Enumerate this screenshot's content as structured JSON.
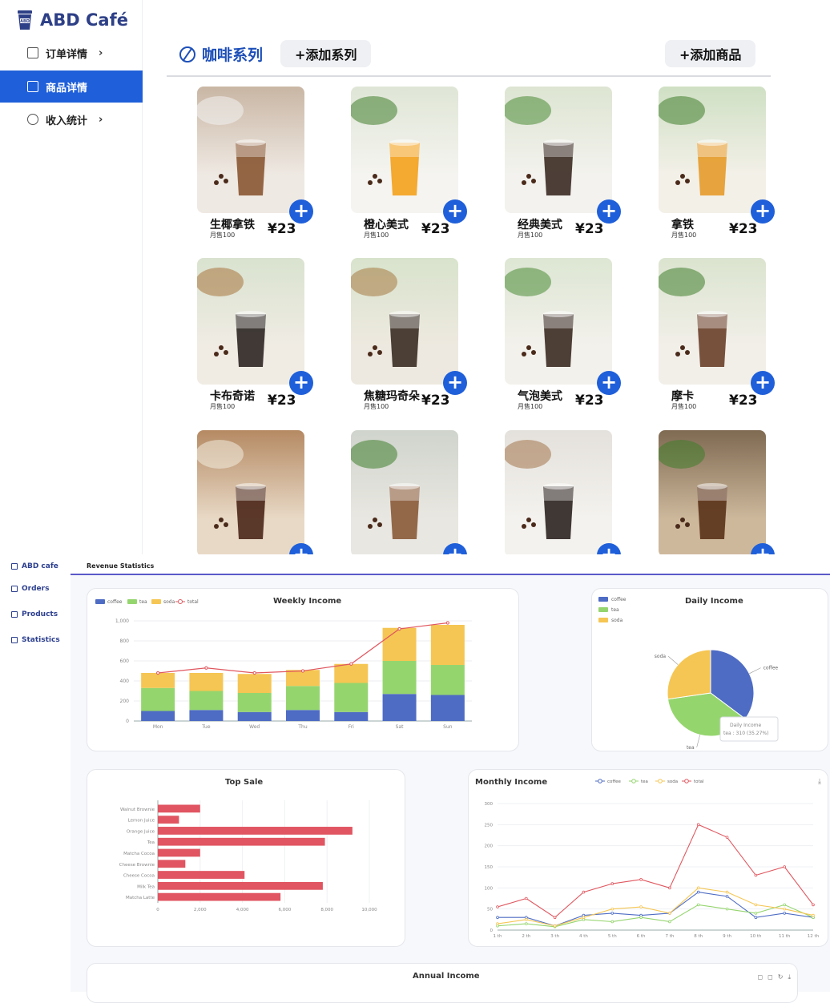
{
  "top": {
    "brand": "ABD Café",
    "nav": [
      {
        "label": "订单详情",
        "chevron": "›",
        "active": false
      },
      {
        "label": "商品详情",
        "chevron": "",
        "active": true
      },
      {
        "label": "收入统计",
        "chevron": "›",
        "active": false
      }
    ],
    "series_title": "咖啡系列",
    "add_series_label": "+添加系列",
    "add_product_label": "+添加商品",
    "plus_glyph": "+",
    "accent": "#1f5fd9",
    "products": [
      {
        "name": "生椰拿铁",
        "sold": "月售100",
        "price": "¥23"
      },
      {
        "name": "橙心美式",
        "sold": "月售100",
        "price": "¥23"
      },
      {
        "name": "经典美式",
        "sold": "月售100",
        "price": "¥23"
      },
      {
        "name": "拿铁",
        "sold": "月售100",
        "price": "¥23"
      },
      {
        "name": "卡布奇诺",
        "sold": "月售100",
        "price": "¥23"
      },
      {
        "name": "焦糖玛奇朵",
        "sold": "月售100",
        "price": "¥23"
      },
      {
        "name": "气泡美式",
        "sold": "月售100",
        "price": "¥23"
      },
      {
        "name": "摩卡",
        "sold": "月售100",
        "price": "¥23"
      },
      {
        "name": "",
        "sold": "",
        "price": ""
      },
      {
        "name": "",
        "sold": "",
        "price": ""
      },
      {
        "name": "",
        "sold": "",
        "price": ""
      },
      {
        "name": "",
        "sold": "",
        "price": ""
      }
    ]
  },
  "bottom": {
    "brand": "ABD cafe",
    "nav": [
      "Orders",
      "Products",
      "Statistics"
    ],
    "header_title": "Revenue Statistics",
    "colors": {
      "coffee": "#4e6cc4",
      "tea": "#95d56e",
      "soda": "#f5c653",
      "total": "#e0575f",
      "bar": "#e05561"
    }
  },
  "chart_data": [
    {
      "type": "bar",
      "title": "Weekly Income",
      "categories": [
        "Mon",
        "Tue",
        "Wed",
        "Thu",
        "Fri",
        "Sat",
        "Sun"
      ],
      "series": [
        {
          "name": "coffee",
          "values": [
            100,
            110,
            90,
            110,
            90,
            270,
            260
          ]
        },
        {
          "name": "tea",
          "values": [
            230,
            190,
            190,
            240,
            290,
            330,
            300
          ]
        },
        {
          "name": "soda",
          "values": [
            150,
            180,
            190,
            160,
            190,
            330,
            400
          ]
        },
        {
          "name": "total",
          "values": [
            480,
            530,
            480,
            500,
            570,
            920,
            980
          ]
        }
      ],
      "ylim": [
        0,
        1000
      ],
      "yticks": [
        "0",
        "200",
        "400",
        "600",
        "800",
        "1,000"
      ],
      "legend": "top-left"
    },
    {
      "type": "pie",
      "title": "Daily Income",
      "labels": [
        "coffee",
        "tea",
        "soda"
      ],
      "values": [
        310,
        330,
        240
      ],
      "legend": "top-left",
      "tooltip": {
        "title": "Daily Income",
        "text": "tea : 310 (35.27%)"
      }
    },
    {
      "type": "bar",
      "orientation": "horizontal",
      "title": "Top Sale",
      "categories": [
        "Walnut Brownie",
        "Lemon Juice",
        "Orange Juice",
        "Tea",
        "Matcha Cocoa",
        "Cheese Brownie",
        "Cheese Cocoa",
        "Milk Tea",
        "Matcha Latte"
      ],
      "values": [
        2000,
        1000,
        9200,
        7900,
        2000,
        1300,
        4100,
        7800,
        5800
      ],
      "xlim": [
        0,
        10000
      ],
      "xticks": [
        "0",
        "2,000",
        "4,000",
        "6,000",
        "8,000",
        "10,000"
      ]
    },
    {
      "type": "line",
      "title": "Monthly Income",
      "categories": [
        "1 th",
        "2 th",
        "3 th",
        "4 th",
        "5 th",
        "6 th",
        "7 th",
        "8 th",
        "9 th",
        "10 th",
        "11 th",
        "12 th"
      ],
      "series": [
        {
          "name": "coffee",
          "values": [
            30,
            30,
            10,
            35,
            40,
            35,
            40,
            90,
            80,
            30,
            40,
            30
          ]
        },
        {
          "name": "tea",
          "values": [
            10,
            15,
            8,
            25,
            20,
            30,
            20,
            60,
            50,
            40,
            60,
            30
          ]
        },
        {
          "name": "soda",
          "values": [
            15,
            25,
            10,
            30,
            50,
            55,
            40,
            100,
            90,
            60,
            50,
            35
          ]
        },
        {
          "name": "total",
          "values": [
            55,
            75,
            30,
            90,
            110,
            120,
            100,
            250,
            220,
            130,
            150,
            60
          ]
        }
      ],
      "ylim": [
        0,
        300
      ],
      "yticks": [
        "0",
        "50",
        "100",
        "150",
        "200",
        "250",
        "300"
      ],
      "legend": "top-center"
    },
    {
      "type": "line",
      "title": "Annual Income"
    }
  ]
}
